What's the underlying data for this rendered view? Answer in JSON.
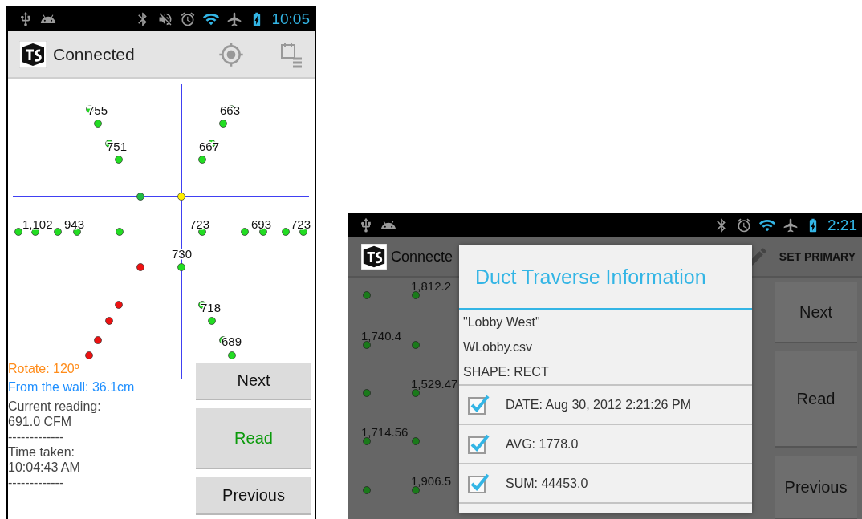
{
  "left_screen": {
    "status_bar": {
      "time": "10:05"
    },
    "action_bar": {
      "title": "Connected"
    },
    "plot": {
      "points": [
        {
          "color": "#22dd22"
        },
        {
          "color": "#22dd22"
        },
        {
          "color": "#22dd22"
        },
        {
          "color": "#22dd22"
        },
        {
          "color": "#22dd22"
        },
        {
          "color": "#22dd22"
        },
        {
          "color": "#22dd22"
        },
        {
          "color": "#22dd22"
        },
        {
          "color": "#22bb44"
        },
        {
          "color": "#ffee00"
        },
        {
          "color": "#22dd22"
        },
        {
          "color": "#22dd22"
        },
        {
          "color": "#22dd22"
        },
        {
          "color": "#22dd22"
        },
        {
          "color": "#22dd22"
        },
        {
          "color": "#22dd22"
        },
        {
          "color": "#22dd22"
        },
        {
          "color": "#22dd22"
        },
        {
          "color": "#22dd22"
        },
        {
          "color": "#22dd22"
        },
        {
          "color": "#22dd22"
        },
        {
          "color": "#ee1111"
        },
        {
          "color": "#ee1111"
        },
        {
          "color": "#ee1111"
        },
        {
          "color": "#ee1111"
        },
        {
          "color": "#ee1111"
        },
        {
          "color": "#22dd22"
        },
        {
          "color": "#22dd22"
        },
        {
          "color": "#22dd22"
        },
        {
          "color": "#22dd22"
        }
      ],
      "labels": [
        "755",
        "663",
        "751",
        "667",
        "1,102",
        "943",
        "723",
        "693",
        "723",
        "730",
        "718",
        "689"
      ]
    },
    "info": [
      {
        "text": "Rotate: 120º",
        "color": "#ff8c1a"
      },
      {
        "text": "From the wall: 36.1cm",
        "color": "#1e8fff"
      },
      {
        "text": "Current reading:",
        "color": "#444444"
      },
      {
        "text": "691.0 CFM",
        "color": "#444444"
      },
      {
        "text": "-------------",
        "color": "#444444"
      },
      {
        "text": "Time taken:",
        "color": "#444444"
      },
      {
        "text": "10:04:43 AM",
        "color": "#444444"
      },
      {
        "text": "-------------",
        "color": "#444444"
      }
    ],
    "buttons": [
      {
        "label": "Next",
        "color": "#111111"
      },
      {
        "label": "Read",
        "color": "#0b9a0b"
      },
      {
        "label": "Previous",
        "color": "#111111"
      }
    ]
  },
  "right_screen": {
    "status_bar": {
      "time": "2:21"
    },
    "action_bar": {
      "title": "Connecte",
      "action": "SET PRIMARY"
    },
    "plot": {
      "labels": [
        "1,812.2",
        "1,740.4",
        "1,529.47",
        "1,714.56",
        "1,906.5"
      ]
    },
    "buttons": [
      "Next",
      "Read",
      "Previous"
    ],
    "dialog": {
      "title": "Duct Traverse Information",
      "lines": [
        "\"Lobby West\"",
        "WLobby.csv",
        "SHAPE: RECT"
      ],
      "options": [
        {
          "label": "DATE: Aug 30, 2012 2:21:26 PM",
          "checked": true
        },
        {
          "label": "AVG: 1778.0",
          "checked": true
        },
        {
          "label": "SUM: 44453.0",
          "checked": true
        }
      ]
    }
  }
}
